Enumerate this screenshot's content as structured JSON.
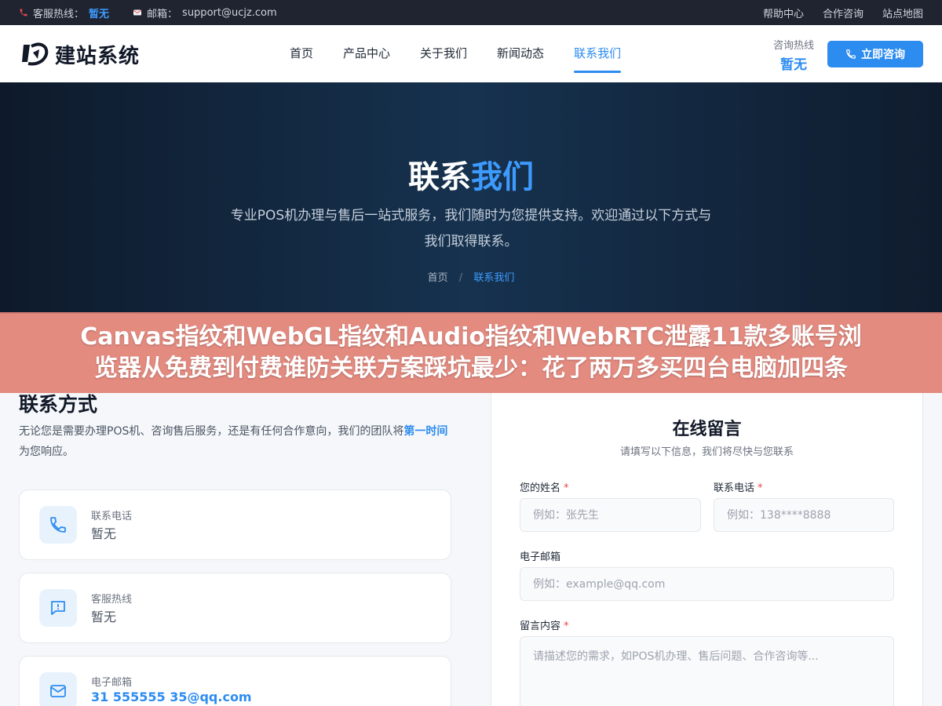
{
  "topbar": {
    "hotline_label": "客服热线：",
    "hotline_value": "暂无",
    "email_label": "邮箱：",
    "email_value": "support@ucjz.com",
    "links": [
      "帮助中心",
      "合作咨询",
      "站点地图"
    ]
  },
  "header": {
    "logo_text": "建站系统",
    "nav": [
      "首页",
      "产品中心",
      "关于我们",
      "新闻动态",
      "联系我们"
    ],
    "active_nav": "联系我们",
    "hotline_label": "咨询热线",
    "hotline_value": "暂无",
    "consult_button": "立即咨询"
  },
  "hero": {
    "title_part1": "联系",
    "title_part2": "我们",
    "description": "专业POS机办理与售后一站式服务，我们随时为您提供支持。欢迎通过以下方式与我们取得联系。",
    "breadcrumb_home": "首页",
    "breadcrumb_sep": "/",
    "breadcrumb_current": "联系我们"
  },
  "banner": {
    "line1": "Canvas指纹和WebGL指纹和Audio指纹和WebRTC泄露11款多账号浏",
    "line2": "览器从免费到付费谁防关联方案踩坑最少：花了两万多买四台电脑加四条"
  },
  "contact": {
    "title": "联系方式",
    "desc_part1": "无论您是需要办理POS机、咨询售后服务，还是有任何合作意向，我们的团队将",
    "desc_emph": "第一时间",
    "desc_part2": "为您响应。",
    "cards": [
      {
        "label": "联系电话",
        "value": "暂无",
        "icon": "phone-icon"
      },
      {
        "label": "客服热线",
        "value": "暂无",
        "icon": "chat-icon"
      },
      {
        "label": "电子邮箱",
        "value": "31 555555 35@qq.com",
        "icon": "mail-icon"
      }
    ]
  },
  "form": {
    "title": "在线留言",
    "subtitle": "请填写以下信息，我们将尽快与您联系",
    "name_label": "您的姓名",
    "name_placeholder": "例如：张先生",
    "phone_label": "联系电话",
    "phone_placeholder": "例如：138****8888",
    "email_label": "电子邮箱",
    "email_placeholder": "例如：example@qq.com",
    "message_label": "留言内容",
    "message_placeholder": "请描述您的需求，如POS机办理、售后问题、合作咨询等...",
    "required_mark": "*"
  },
  "colors": {
    "accent": "#2d8cf0",
    "topbar_bg": "#1f2430",
    "hero_bg": "#16324f",
    "banner_bg": "#e28276"
  }
}
